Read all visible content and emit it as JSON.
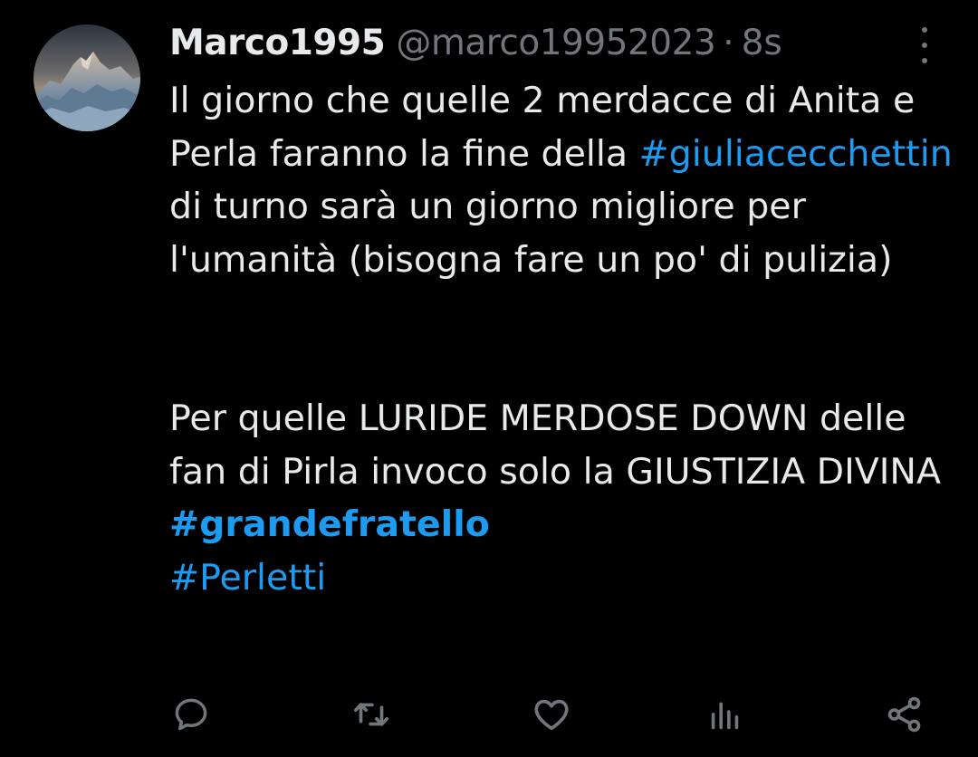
{
  "tweet": {
    "author": {
      "display_name": "Marco1995",
      "handle": "@marco19952023",
      "separator": "·",
      "time": "8s",
      "avatar_icon": "avatar-mountain-photo"
    },
    "body": {
      "paragraph1": {
        "text_a": "Il giorno che quelle 2 merdacce di Anita e Perla faranno la fine della ",
        "hashtag1": "#giuliacecchettin",
        "text_b": " di turno sarà un giorno migliore per l'umanità (bisogna fare un po' di pulizia)"
      },
      "paragraph2": {
        "text_a": "Per quelle LURIDE MERDOSE DOWN delle fan di Pirla invoco solo la GIUSTIZIA DIVINA ",
        "hashtag2": "#grandefratello",
        "hashtag3": "#Perletti"
      }
    },
    "actions": {
      "reply_icon": "reply-icon",
      "retweet_icon": "retweet-icon",
      "like_icon": "like-icon",
      "views_icon": "views-icon",
      "share_icon": "share-icon"
    },
    "more_icon": "more-vertical-icon"
  },
  "colors": {
    "background": "#000000",
    "text_primary": "#e7e9ea",
    "text_secondary": "#71767b",
    "accent": "#1d9bf0"
  }
}
